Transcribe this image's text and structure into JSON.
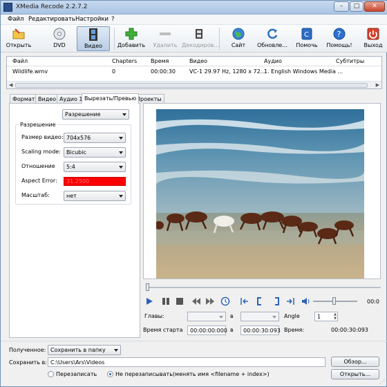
{
  "window": {
    "title": "XMedia Recode 2.2.7.2",
    "minimize": "–",
    "maximize": "□",
    "close": "✕"
  },
  "menu": [
    "Файл",
    "Редактировать",
    "Настройки",
    "?"
  ],
  "toolbar": {
    "buttons": [
      {
        "label": "Открыть",
        "icon": "open-folder-icon"
      },
      {
        "label": "DVD",
        "icon": "dvd-icon"
      },
      {
        "label": "Видео",
        "icon": "film-icon",
        "active": true
      },
      {
        "label": "Добавить",
        "icon": "plus-icon"
      },
      {
        "label": "Удалить",
        "icon": "minus-icon",
        "disabled": true
      },
      {
        "label": "Декодиров...",
        "icon": "film-reel-icon",
        "disabled": true
      },
      {
        "label": "Сайт",
        "icon": "globe-icon"
      },
      {
        "label": "Обновле...",
        "icon": "refresh-icon"
      },
      {
        "label": "Помочь",
        "icon": "help-book-icon"
      },
      {
        "label": "Помощь!",
        "icon": "question-icon"
      },
      {
        "label": "Выход",
        "icon": "exit-icon"
      }
    ]
  },
  "filelist": {
    "columns": [
      "Файл",
      "Chapters",
      "Время",
      "Видео",
      "Аудио",
      "Субтитры"
    ],
    "rows": [
      [
        "Wildlife.wmv",
        "0",
        "00:00:30",
        "VC-1 29.97 Hz, 1280 x 72...",
        "1. English Windows Media ...",
        ""
      ]
    ]
  },
  "tabs": [
    "Формат",
    "Видео",
    "Аудио 1",
    "Вырезать/Превью",
    "Проекты"
  ],
  "selected_tab": 3,
  "panel": {
    "mode": "Разрешение",
    "group_title": "Разрешение",
    "fields": [
      {
        "label": "Размер видео:",
        "value": "704x576"
      },
      {
        "label": "Scaling mode:",
        "value": "Bicubic"
      },
      {
        "label": "Отношение",
        "value": "5:4"
      },
      {
        "label": "Aspect Error:",
        "value": "31.2500",
        "error": true
      },
      {
        "label": "Масштаб:",
        "value": "нет"
      }
    ]
  },
  "controls": {
    "chapters_label": "Главы:",
    "v_label1": "в",
    "angle_label": "Angle",
    "angle_value": "1",
    "start_label": "Время старта",
    "start_value": "00:00:00:000",
    "v_label2": "в",
    "end_value": "00:00:30:093",
    "time_label": "Время:",
    "time_value": "00:00:30:093",
    "edge_time": "00:0"
  },
  "bottom": {
    "output_label": "Полученное:",
    "output_value": "Сохранить в папку",
    "save_label": "Сохранить в:",
    "save_path": "C:\\Users\\Ars\\Videos",
    "browse": "Обзор...",
    "overwrite": "Перезаписать",
    "no_overwrite": "Не перезаписывать(менять имя <filename + index>)",
    "open": "Открыть..."
  }
}
